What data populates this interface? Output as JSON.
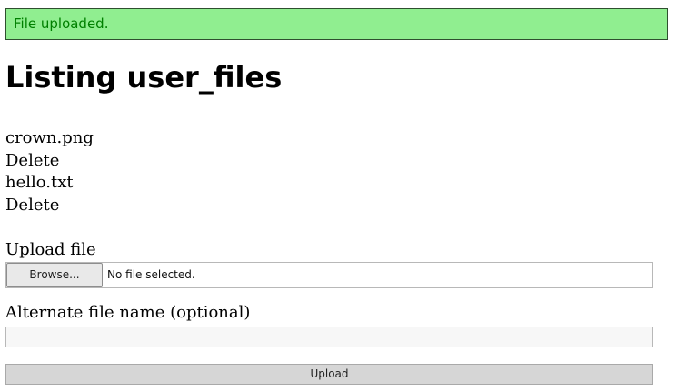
{
  "notice": {
    "text": "File uploaded."
  },
  "page": {
    "title": "Listing user_files"
  },
  "files": [
    {
      "name": "crown.png",
      "delete_label": "Delete"
    },
    {
      "name": "hello.txt",
      "delete_label": "Delete"
    }
  ],
  "upload_form": {
    "file_label": "Upload file",
    "browse_label": "Browse...",
    "file_status": "No file selected.",
    "alt_name_label": "Alternate file name (optional)",
    "alt_name_value": "",
    "submit_label": "Upload"
  },
  "colors": {
    "notice_background": "#90ee90",
    "notice_text": "#008000"
  }
}
